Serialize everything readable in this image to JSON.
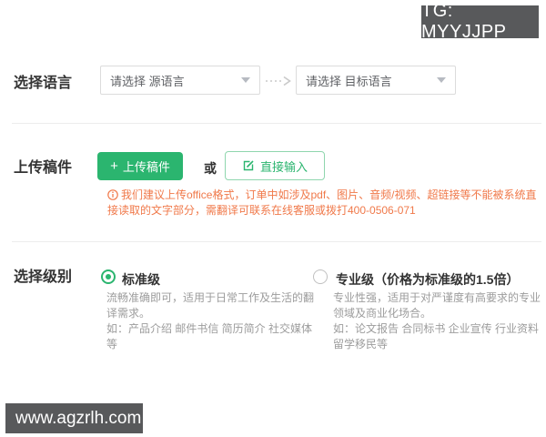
{
  "watermark": {
    "tg": "TG: MYYJJPP",
    "site": "www.agzrlh.com"
  },
  "language": {
    "label": "选择语言",
    "source_placeholder": "请选择 源语言",
    "target_placeholder": "请选择 目标语言"
  },
  "upload": {
    "label": "上传稿件",
    "upload_button_label": "上传稿件",
    "or_label": "或",
    "direct_input_label": "直接输入",
    "notice": "我们建议上传office格式，订单中如涉及pdf、图片、音频/视频、超链接等不能被系统直接读取的文字部分，需翻译可联系在线客服或拨打400-0506-071"
  },
  "level": {
    "label": "选择级别",
    "options": [
      {
        "name": "标准级",
        "selected": true,
        "desc": "流畅准确即可，适用于日常工作及生活的翻译需求。",
        "examples": "如：产品介绍 邮件书信 简历简介 社交媒体 等"
      },
      {
        "name": "专业级（价格为标准级的1.5倍）",
        "selected": false,
        "desc": "专业性强，适用于对严谨度有高要求的专业领域及商业化场合。",
        "examples": "如：论文报告 合同标书 企业宣传 行业资料 留学移民等"
      }
    ]
  },
  "icons": {
    "plus": "+"
  },
  "colors": {
    "accent_green": "#2bb56f",
    "outline_green": "#8fd6ae",
    "warning_orange": "#f0794a",
    "badge_gray": "#58595b",
    "border_gray": "#dcdcdc",
    "text_dark": "#333333",
    "text_muted": "#9c9c9c"
  }
}
